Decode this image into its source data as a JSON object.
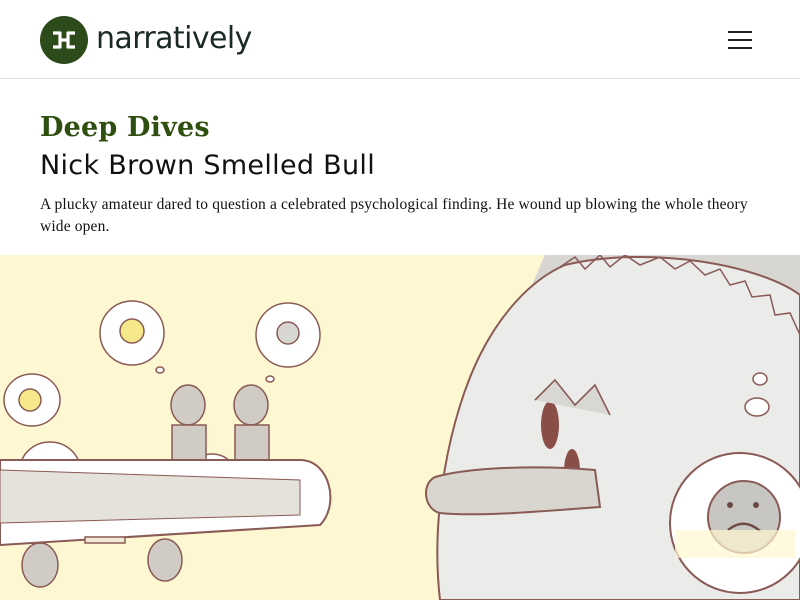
{
  "header": {
    "brand_name": "narratively",
    "logo_icon": "narratively-n-logo-icon",
    "menu_icon": "hamburger-menu-icon",
    "brand_color": "#2d4a1b"
  },
  "article": {
    "category": "Deep Dives",
    "title": "Nick Brown Smelled Bull",
    "dek": "A plucky amateur dared to question a celebrated psychological finding. He wound up blowing the whole theory wide open.",
    "category_color": "#2f4f11"
  },
  "hero_image": {
    "description_icon": "illustration-hero",
    "background_color": "#fef8d2"
  }
}
